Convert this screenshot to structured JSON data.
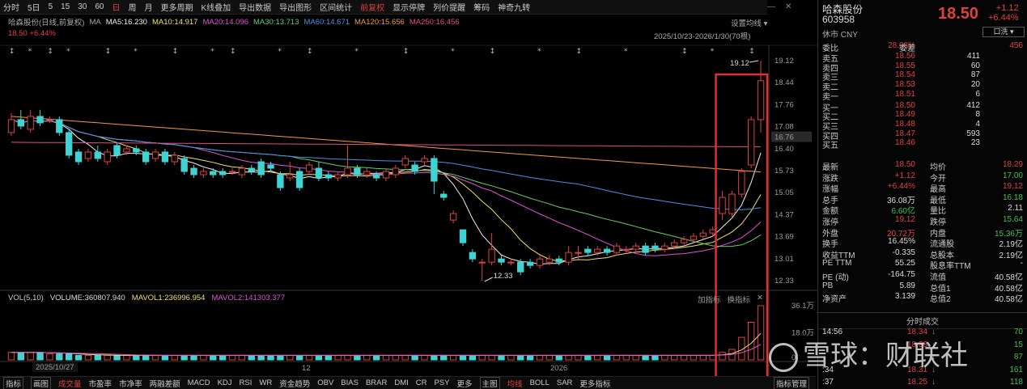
{
  "toolbar": {
    "items": [
      "分时",
      "5日",
      "5",
      "15",
      "30",
      "60",
      "日",
      "周",
      "月",
      "更多周期",
      "K线叠加",
      "导出数据",
      "导出图形",
      "区间统计",
      "前复权",
      "显示停牌",
      "列价提醒",
      "筹码",
      "神奇九转"
    ],
    "active_index": 6,
    "highlight_index": 14
  },
  "info_row": {
    "name_label": "哈森股份(日线,前复权)",
    "ma_label": "MA",
    "ma5": "MA5:16.230",
    "ma10": "MA10:14.917",
    "ma20": "MA20:14.096",
    "ma30": "MA30:13.713",
    "ma60": "MA60:14.671",
    "ma120": "MA120:15.656",
    "ma250": "MA250:16.456",
    "change_line": "18.50 +6.44%",
    "settings": "设置均线",
    "range": "2025/10/23-2026/1/30(70根)"
  },
  "colors": {
    "up": "#e04040",
    "down": "#41d3d3",
    "ma5": "#f0f0f0",
    "ma10": "#f0e06a",
    "ma20": "#e44fd8",
    "ma30": "#61d061",
    "ma60": "#4a8fe8",
    "ma120": "#f29a3a",
    "ma250": "#e04d88"
  },
  "price_axis": [
    "19.12",
    "18.44",
    "17.76",
    "17.08",
    "16.76",
    "16.40",
    "15.73",
    "15.05",
    "14.37",
    "13.69",
    "13.01",
    "12.33"
  ],
  "annotations": {
    "high": "19.12",
    "low": "12.33"
  },
  "volume": {
    "title": "VOL(5,10)",
    "volume": "VOLUME:360807.940",
    "mavol1": "MAVOL1:236996.954",
    "mavol2": "MAVOL2:141303.377",
    "tools": [
      "加指标",
      "换指标"
    ],
    "axis": [
      "36.1万",
      "18.0万",
      "0"
    ]
  },
  "dates": {
    "start": "2025/10/27",
    "tick1": "12",
    "tick2": "2026"
  },
  "bottom_bar": [
    "指标",
    "画图",
    "成交量",
    "市盈率",
    "市净率",
    "两融差额",
    "MACD",
    "KDJ",
    "RSI",
    "WR",
    "资金趋势",
    "OBV",
    "BIAS",
    "BRAR",
    "DMI",
    "CR",
    "PSY",
    "更多",
    "主图",
    "均线",
    "BOLL",
    "SAR",
    "更多指标",
    "指标管理"
  ],
  "stock": {
    "name": "哈森股份",
    "code": "603958",
    "market": "休市 CNY",
    "price": "18.50",
    "change": "+1.12",
    "change_pct": "+6.44%",
    "button": "口洗 ▾"
  },
  "order_book": {
    "ratio": {
      "label": "委比",
      "value": "28.08%",
      "label2": "委差",
      "value2": "456"
    },
    "asks": [
      {
        "label": "卖五",
        "price": "18.56",
        "vol": "411"
      },
      {
        "label": "卖四",
        "price": "18.55",
        "vol": "60"
      },
      {
        "label": "卖三",
        "price": "18.54",
        "vol": "87"
      },
      {
        "label": "卖二",
        "price": "18.53",
        "vol": "20"
      },
      {
        "label": "卖一",
        "price": "18.51",
        "vol": "6"
      }
    ],
    "bids": [
      {
        "label": "买一",
        "price": "18.50",
        "vol": "412"
      },
      {
        "label": "买二",
        "price": "18.49",
        "vol": "8"
      },
      {
        "label": "买三",
        "price": "18.48",
        "vol": "4"
      },
      {
        "label": "买四",
        "price": "18.47",
        "vol": "593"
      },
      {
        "label": "买五",
        "price": "18.46",
        "vol": "23"
      }
    ]
  },
  "stats": [
    {
      "l1": "最新",
      "v1": "18.50",
      "c1": "red",
      "l2": "均价",
      "v2": "18.29",
      "c2": "red"
    },
    {
      "l1": "涨跌",
      "v1": "+1.12",
      "c1": "red",
      "l2": "今开",
      "v2": "17.00",
      "c2": "green"
    },
    {
      "l1": "涨幅",
      "v1": "+6.44%",
      "c1": "red",
      "l2": "最高",
      "v2": "19.12",
      "c2": "red"
    },
    {
      "l1": "总手",
      "v1": "36.08万",
      "c1": "white",
      "l2": "最低",
      "v2": "16.18",
      "c2": "green"
    },
    {
      "l1": "金额",
      "v1": "6.60亿",
      "c1": "green",
      "l2": "量比",
      "v2": "2.11",
      "c2": "white"
    },
    {
      "l1": "涨停",
      "v1": "19.12",
      "c1": "red",
      "l2": "跌停",
      "v2": "15.64",
      "c2": "green"
    },
    {
      "l1": "外盘",
      "v1": "20.72万",
      "c1": "red",
      "l2": "内盘",
      "v2": "15.36万",
      "c2": "green"
    },
    {
      "l1": "换手",
      "v1": "16.45%",
      "c1": "white",
      "l2": "流通股",
      "v2": "2.19亿",
      "c2": "white"
    },
    {
      "l1": "收益TTM",
      "v1": "-0.335",
      "c1": "white",
      "l2": "总股本",
      "v2": "2.19亿",
      "c2": "white"
    },
    {
      "l1": "PE TTM",
      "v1": "55.25",
      "c1": "white",
      "l2": "股息率TTM",
      "v2": "-",
      "c2": "white"
    },
    {
      "l1": "PE (动)",
      "v1": "-164.75",
      "c1": "white",
      "l2": "流值",
      "v2": "40.58亿",
      "c2": "white"
    },
    {
      "l1": "PB",
      "v1": "5.89",
      "c1": "white",
      "l2": "总值1",
      "v2": "40.58亿",
      "c2": "white"
    },
    {
      "l1": "净资产",
      "v1": "3.139",
      "c1": "white",
      "l2": "总值2",
      "v2": "40.58亿",
      "c2": "white"
    }
  ],
  "ticks": {
    "header": "分时成交",
    "rows": [
      {
        "time": "14:56",
        "price": "18.34",
        "arrow": "↓",
        "vol": "70"
      },
      {
        "time": "",
        "price": "18.33",
        "arrow": "↓",
        "vol": "15"
      },
      {
        "time": "",
        "price": "",
        "arrow": "↓",
        "vol": "87"
      },
      {
        "time": ":34",
        "price": "18.31",
        "arrow": "↓",
        "vol": "161"
      },
      {
        "time": ":37",
        "price": "18.25",
        "arrow": "↓",
        "vol": "118"
      }
    ]
  },
  "watermark": "雪球：财联社",
  "chart_data": {
    "type": "candlestick",
    "title": "哈森股份(日线,前复权)",
    "ylim": [
      12.33,
      19.12
    ],
    "candles": [
      {
        "o": 16.9,
        "c": 17.3,
        "h": 17.5,
        "l": 16.8
      },
      {
        "o": 17.3,
        "c": 17.1,
        "h": 17.6,
        "l": 17.0
      },
      {
        "o": 17.0,
        "c": 17.4,
        "h": 17.6,
        "l": 16.9
      },
      {
        "o": 17.4,
        "c": 17.2,
        "h": 17.6,
        "l": 17.1
      },
      {
        "o": 17.3,
        "c": 17.3,
        "h": 17.4,
        "l": 17.2
      },
      {
        "o": 17.3,
        "c": 16.9,
        "h": 17.4,
        "l": 16.8
      },
      {
        "o": 16.9,
        "c": 16.2,
        "h": 17.0,
        "l": 16.1
      },
      {
        "o": 16.3,
        "c": 16.0,
        "h": 16.4,
        "l": 15.9
      },
      {
        "o": 16.1,
        "c": 16.3,
        "h": 16.4,
        "l": 16.0
      },
      {
        "o": 16.3,
        "c": 16.1,
        "h": 16.5,
        "l": 16.0
      },
      {
        "o": 16.0,
        "c": 16.3,
        "h": 16.4,
        "l": 15.9
      },
      {
        "o": 16.5,
        "c": 16.2,
        "h": 16.6,
        "l": 16.1
      },
      {
        "o": 16.3,
        "c": 16.4,
        "h": 16.5,
        "l": 16.2
      },
      {
        "o": 16.4,
        "c": 16.3,
        "h": 16.5,
        "l": 16.2
      },
      {
        "o": 16.3,
        "c": 16.0,
        "h": 16.4,
        "l": 15.9
      },
      {
        "o": 16.1,
        "c": 16.3,
        "h": 16.4,
        "l": 16.0
      },
      {
        "o": 16.3,
        "c": 16.0,
        "h": 16.4,
        "l": 15.9
      },
      {
        "o": 16.0,
        "c": 16.2,
        "h": 16.3,
        "l": 15.9
      },
      {
        "o": 16.1,
        "c": 15.7,
        "h": 16.2,
        "l": 15.6
      },
      {
        "o": 15.8,
        "c": 15.6,
        "h": 15.9,
        "l": 15.5
      },
      {
        "o": 15.6,
        "c": 15.7,
        "h": 15.8,
        "l": 15.5
      },
      {
        "o": 15.7,
        "c": 15.6,
        "h": 15.8,
        "l": 15.5
      },
      {
        "o": 15.7,
        "c": 15.6,
        "h": 15.8,
        "l": 15.5
      },
      {
        "o": 15.7,
        "c": 15.7,
        "h": 15.8,
        "l": 15.6
      },
      {
        "o": 15.6,
        "c": 15.8,
        "h": 15.9,
        "l": 15.5
      },
      {
        "o": 15.8,
        "c": 15.7,
        "h": 15.9,
        "l": 15.6
      },
      {
        "o": 16.0,
        "c": 15.6,
        "h": 16.1,
        "l": 15.5
      },
      {
        "o": 15.9,
        "c": 15.8,
        "h": 16.0,
        "l": 15.7
      },
      {
        "o": 15.6,
        "c": 15.2,
        "h": 15.7,
        "l": 15.1
      },
      {
        "o": 15.5,
        "c": 15.6,
        "h": 16.0,
        "l": 15.4
      },
      {
        "o": 15.7,
        "c": 15.2,
        "h": 15.8,
        "l": 15.1
      },
      {
        "o": 15.7,
        "c": 15.9,
        "h": 16.0,
        "l": 15.6
      },
      {
        "o": 15.8,
        "c": 15.5,
        "h": 16.0,
        "l": 15.4
      },
      {
        "o": 15.6,
        "c": 15.5,
        "h": 15.7,
        "l": 15.4
      },
      {
        "o": 15.5,
        "c": 15.6,
        "h": 15.7,
        "l": 15.4
      },
      {
        "o": 15.6,
        "c": 15.8,
        "h": 16.5,
        "l": 15.5
      },
      {
        "o": 15.8,
        "c": 15.6,
        "h": 15.9,
        "l": 15.5
      },
      {
        "o": 15.6,
        "c": 15.7,
        "h": 15.8,
        "l": 15.5
      },
      {
        "o": 15.6,
        "c": 15.5,
        "h": 15.7,
        "l": 15.4
      },
      {
        "o": 15.5,
        "c": 15.7,
        "h": 15.8,
        "l": 15.4
      },
      {
        "o": 15.6,
        "c": 15.8,
        "h": 15.9,
        "l": 15.5
      },
      {
        "o": 15.9,
        "c": 16.1,
        "h": 16.2,
        "l": 15.8
      },
      {
        "o": 15.9,
        "c": 15.7,
        "h": 16.0,
        "l": 15.6
      },
      {
        "o": 16.0,
        "c": 16.1,
        "h": 16.2,
        "l": 15.9
      },
      {
        "o": 16.1,
        "c": 15.4,
        "h": 16.2,
        "l": 15.0
      },
      {
        "o": 15.0,
        "c": 14.9,
        "h": 15.1,
        "l": 14.8
      },
      {
        "o": 14.2,
        "c": 14.4,
        "h": 14.5,
        "l": 14.1
      },
      {
        "o": 13.9,
        "c": 13.5,
        "h": 13.9,
        "l": 13.4
      },
      {
        "o": 13.2,
        "c": 13.0,
        "h": 13.3,
        "l": 12.9
      },
      {
        "o": 12.9,
        "c": 12.9,
        "h": 13.0,
        "l": 12.33
      },
      {
        "o": 12.9,
        "c": 13.3,
        "h": 13.8,
        "l": 12.8
      },
      {
        "o": 13.0,
        "c": 12.9,
        "h": 13.1,
        "l": 12.8
      },
      {
        "o": 12.9,
        "c": 12.9,
        "h": 13.0,
        "l": 12.8
      },
      {
        "o": 12.9,
        "c": 12.6,
        "h": 13.0,
        "l": 12.5
      },
      {
        "o": 12.9,
        "c": 12.8,
        "h": 13.0,
        "l": 12.7
      },
      {
        "o": 12.8,
        "c": 13.0,
        "h": 13.1,
        "l": 12.7
      },
      {
        "o": 12.9,
        "c": 13.0,
        "h": 13.1,
        "l": 12.8
      },
      {
        "o": 13.0,
        "c": 12.9,
        "h": 13.1,
        "l": 12.8
      },
      {
        "o": 12.9,
        "c": 13.2,
        "h": 13.4,
        "l": 12.8
      },
      {
        "o": 13.2,
        "c": 13.2,
        "h": 13.4,
        "l": 13.0
      },
      {
        "o": 13.3,
        "c": 13.2,
        "h": 13.4,
        "l": 13.1
      },
      {
        "o": 13.2,
        "c": 13.3,
        "h": 13.4,
        "l": 13.1
      },
      {
        "o": 13.3,
        "c": 13.2,
        "h": 13.4,
        "l": 13.1
      },
      {
        "o": 13.2,
        "c": 13.4,
        "h": 13.5,
        "l": 13.1
      },
      {
        "o": 13.3,
        "c": 13.3,
        "h": 13.4,
        "l": 13.2
      },
      {
        "o": 13.3,
        "c": 13.4,
        "h": 13.5,
        "l": 13.2
      },
      {
        "o": 13.4,
        "c": 13.2,
        "h": 13.5,
        "l": 13.1
      },
      {
        "o": 13.4,
        "c": 13.3,
        "h": 13.5,
        "l": 13.2
      },
      {
        "o": 13.3,
        "c": 13.4,
        "h": 13.5,
        "l": 13.2
      },
      {
        "o": 13.4,
        "c": 13.5,
        "h": 13.6,
        "l": 13.3
      },
      {
        "o": 13.5,
        "c": 13.6,
        "h": 13.7,
        "l": 13.4
      },
      {
        "o": 13.6,
        "c": 13.7,
        "h": 13.8,
        "l": 13.5
      },
      {
        "o": 13.7,
        "c": 13.8,
        "h": 13.9,
        "l": 13.6
      },
      {
        "o": 13.8,
        "c": 13.9,
        "h": 14.0,
        "l": 13.7
      },
      {
        "o": 14.4,
        "c": 14.9,
        "h": 15.1,
        "l": 14.2
      },
      {
        "o": 14.4,
        "c": 15.0,
        "h": 15.1,
        "l": 14.3
      },
      {
        "o": 15.0,
        "c": 15.7,
        "h": 15.8,
        "l": 14.9
      },
      {
        "o": 15.9,
        "c": 17.3,
        "h": 17.4,
        "l": 15.8
      },
      {
        "o": 17.3,
        "c": 18.5,
        "h": 19.12,
        "l": 16.9
      }
    ],
    "volume": [
      5,
      5,
      5,
      5,
      4,
      4,
      4,
      3,
      3,
      3,
      3,
      3,
      3,
      3,
      3,
      3,
      3,
      3,
      3,
      3,
      3,
      3,
      3,
      3,
      3,
      3,
      3,
      3,
      3,
      3,
      3,
      3,
      3,
      3,
      3,
      3,
      3,
      3,
      3,
      3,
      3,
      3,
      3,
      3,
      3,
      3,
      3,
      3,
      3,
      3,
      3,
      3,
      3,
      3,
      3,
      3,
      3,
      3,
      3,
      3,
      3,
      3,
      3,
      3,
      3,
      3,
      3,
      3,
      3,
      3,
      3,
      3,
      3,
      3,
      5,
      7,
      15,
      25,
      36
    ]
  }
}
